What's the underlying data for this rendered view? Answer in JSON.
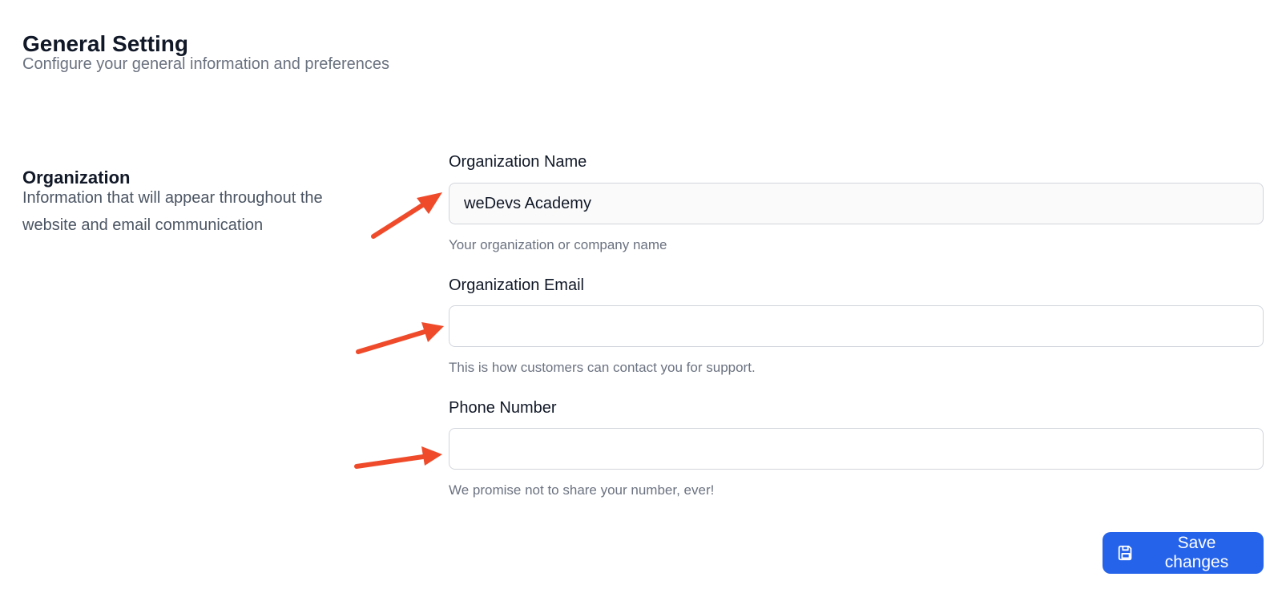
{
  "page": {
    "title": "General Setting",
    "subtitle": "Configure your general information and preferences"
  },
  "section": {
    "title": "Organization",
    "description": "Information that will appear throughout the website and email communication"
  },
  "fields": [
    {
      "label": "Organization Name",
      "value": "weDevs Academy",
      "help": "Your organization or company name"
    },
    {
      "label": "Organization Email",
      "value": "",
      "help": "This is how customers can contact you for support."
    },
    {
      "label": "Phone Number",
      "value": "",
      "help": "We promise not to share your number, ever!"
    }
  ],
  "actions": {
    "save_label": "Save changes",
    "save_icon": "floppy-disk-icon"
  },
  "colors": {
    "accent": "#2563eb",
    "annotation_arrow": "#ef4b2b",
    "muted_text": "#6b7280",
    "border": "#d1d5db"
  }
}
